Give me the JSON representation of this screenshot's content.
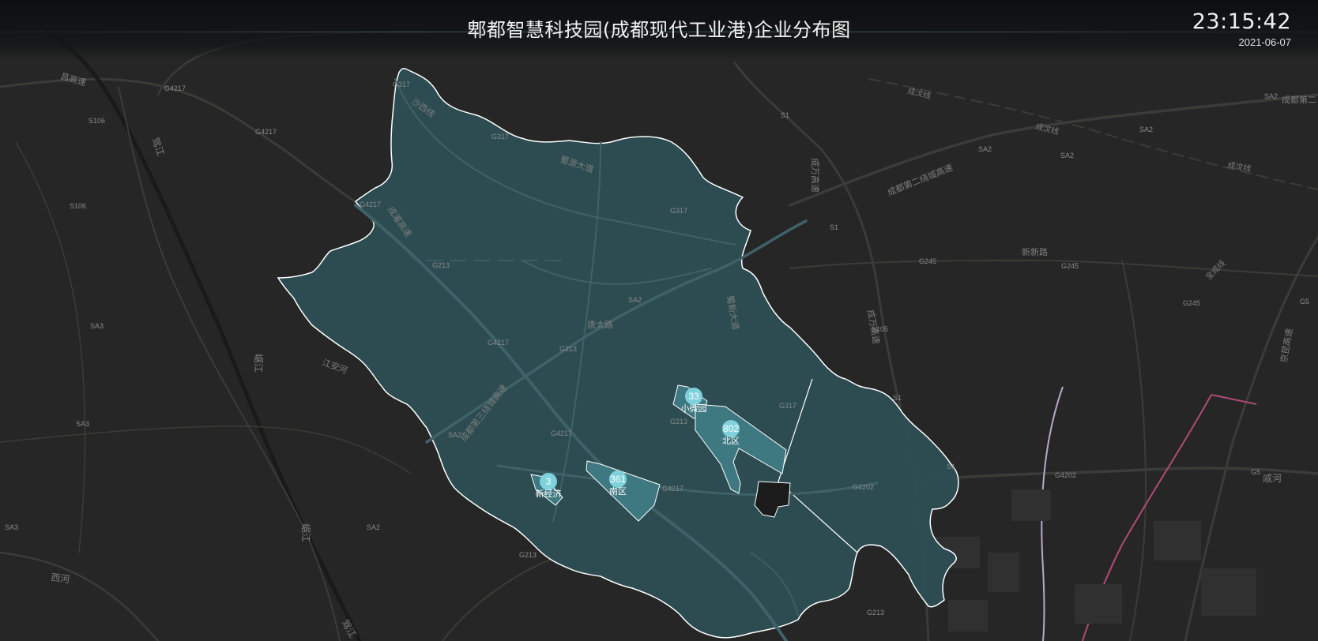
{
  "header": {
    "title": "郫都智慧科技园(成都现代工业港)企业分布图",
    "time": "23:15:42",
    "date": "2021-06-07"
  },
  "colors": {
    "background": "#262626",
    "district_fill": "#2c4f55",
    "district_stroke": "#ffffff",
    "zone_fill": "#3e7880",
    "pin": "#7fd1dc",
    "road": "#3a3a38",
    "river": "#181818"
  },
  "zones": [
    {
      "name": "小微园",
      "count": "33"
    },
    {
      "name": "北区",
      "count": "802"
    },
    {
      "name": "南区",
      "count": "361"
    },
    {
      "name": "新经济",
      "count": "3"
    }
  ],
  "map_labels": {
    "road_names": [
      "沙西线",
      "蜀源大道",
      "唐太路",
      "蜀新大道",
      "成都第二绕城高速",
      "成万高速",
      "新新路",
      "成汶线",
      "成都第二",
      "京昆高速",
      "宝成线",
      "成灌高速",
      "江安河",
      "西河",
      "崌江",
      "驾江",
      "昌高速",
      "成都第三绕城高速",
      "戚河"
    ],
    "road_codes": [
      "G317",
      "G4217",
      "S106",
      "SA3",
      "SA2",
      "S1",
      "G213",
      "G245",
      "G5",
      "S105",
      "G4202"
    ]
  }
}
